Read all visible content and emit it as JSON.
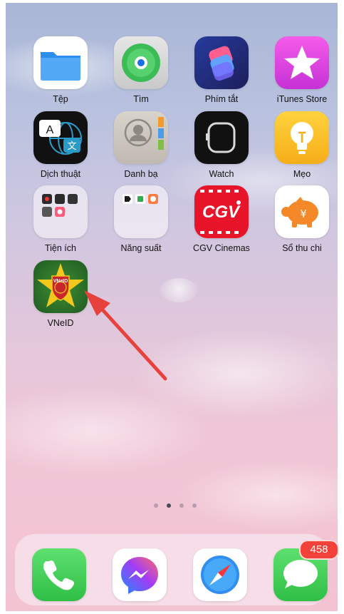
{
  "apps": [
    {
      "label": "Tệp",
      "icon": "folder-icon"
    },
    {
      "label": "Tìm",
      "icon": "find-my-icon"
    },
    {
      "label": "Phím tắt",
      "icon": "shortcuts-icon"
    },
    {
      "label": "iTunes Store",
      "icon": "star-icon"
    },
    {
      "label": "Dịch thuật",
      "icon": "translate-icon"
    },
    {
      "label": "Danh bạ",
      "icon": "contacts-icon"
    },
    {
      "label": "Watch",
      "icon": "watch-icon"
    },
    {
      "label": "Mẹo",
      "icon": "lightbulb-icon"
    },
    {
      "label": "Tiện ích",
      "icon": "utilities-folder-icon"
    },
    {
      "label": "Năng suất",
      "icon": "productivity-folder-icon"
    },
    {
      "label": "CGV Cinemas",
      "icon": "cgv-logo-icon"
    },
    {
      "label": "Sổ thu chi",
      "icon": "piggy-bank-icon"
    },
    {
      "label": "VNeID",
      "icon": "vneid-emblem-icon"
    }
  ],
  "icon_text": {
    "translate_a": "A",
    "translate_cjk": "文",
    "cgv": "CGV",
    "piggy_yen": "¥",
    "vneid_logo": "VNeID"
  },
  "page_indicator": {
    "pages": 4,
    "current": 2
  },
  "dock": [
    {
      "name": "phone",
      "icon": "phone-icon"
    },
    {
      "name": "messenger",
      "icon": "messenger-icon"
    },
    {
      "name": "safari",
      "icon": "compass-icon"
    },
    {
      "name": "messages",
      "icon": "message-bubble-icon"
    }
  ],
  "messages_badge": "458",
  "colors": {
    "arrow": "#e6413d",
    "badge": "#f2423a",
    "ios_green": "#34c759"
  }
}
